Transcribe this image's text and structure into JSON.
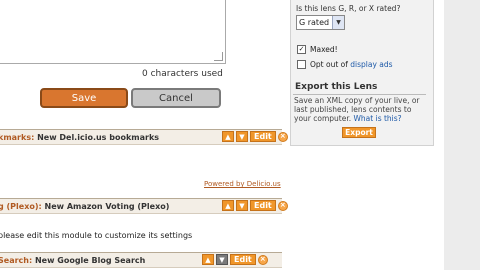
{
  "editor": {
    "char_count": "0 characters used",
    "save_label": "Save",
    "cancel_label": "Cancel"
  },
  "modules": [
    {
      "prefix": "kmarks:",
      "title": "New Del.icio.us bookmarks",
      "edit_label": "Edit",
      "up_active": true
    },
    {
      "prefix": "g (Plexo):",
      "title": "New Amazon Voting (Plexo)",
      "edit_label": "Edit",
      "up_active": true
    },
    {
      "prefix": "Search:",
      "title": "New Google Blog Search",
      "edit_label": "Edit",
      "up_active": false
    }
  ],
  "powered_by": "Powered by Delicio.us",
  "module_notice": "please edit this module to customize its settings",
  "sidebar": {
    "rating_question": "Is this lens G, R, or X rated?",
    "rating_selected": "G rated",
    "maxed_label": "Maxed!",
    "maxed_checked": true,
    "optout_prefix": "Opt out of ",
    "optout_link": "display ads",
    "optout_checked": false,
    "export_title": "Export this Lens",
    "export_desc_1": "Save an XML copy of your live, or last published, lens contents to your computer.",
    "export_desc_link": "What is this?",
    "export_button": "Export"
  },
  "icons": {
    "move_up": "arrow-up-icon",
    "move_down": "arrow-down-icon",
    "close": "close-icon",
    "dropdown": "chevron-down-icon",
    "check": "checkmark-icon"
  },
  "colors": {
    "accent_orange": "#f0962a",
    "save_button": "#d9762f",
    "module_title": "#b05a22",
    "link_blue": "#1e5aa8"
  }
}
